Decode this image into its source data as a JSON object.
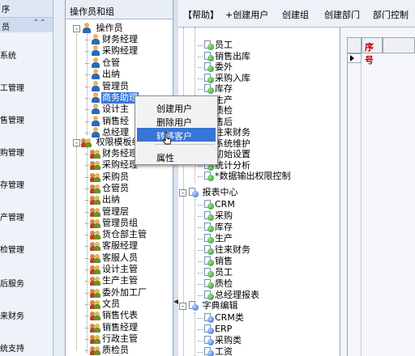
{
  "leftnav": {
    "header": "序",
    "top_item": "员",
    "items": [
      "系统",
      "工管理",
      "售管理",
      "购管理",
      "存管理",
      "产管理",
      "检管理",
      "后服务",
      "来财务",
      "统支持"
    ]
  },
  "tree": {
    "title": "操作员和组",
    "operators_root": "操作员",
    "operators": [
      "财务经理",
      "采购经理",
      "仓管",
      "出纳",
      "管理员",
      "商务助理",
      "设计主",
      "销售经",
      "总经理"
    ],
    "groups_root": "权限模板组",
    "groups": [
      "财务经理",
      "采购经理",
      "采购员",
      "仓管员",
      "出纳",
      "管理层",
      "管理员组",
      "货仓部主管",
      "客服经理",
      "客服人员",
      "设计主管",
      "生产主管",
      "委外加工厂",
      "文员",
      "销售代表",
      "销售经理",
      "行政主管",
      "质检员"
    ]
  },
  "context_menu": {
    "items": [
      "创建用户",
      "删除用户",
      "转移客户",
      "属性"
    ]
  },
  "toolbar": {
    "help": "【帮助】",
    "create_user": "+创建用户",
    "create_group": "创建组",
    "create_dept": "创建部门",
    "dept_control": "部门控制"
  },
  "rtree": {
    "group1_items": [
      "员工",
      "销售出库",
      "委外",
      "采购入库",
      "库存",
      "生产",
      "质检",
      "售后",
      "往来财务",
      "系统维护",
      "初始设置",
      "统计分析",
      "*数据输出权限控制"
    ],
    "report_center": "报表中心",
    "report_items": [
      "CRM",
      "采购",
      "库存",
      "生产",
      "往来财务",
      "销售",
      "员工",
      "质检",
      "总经理报表"
    ],
    "dict_editor": "字典编辑",
    "dict_items": [
      "CRM类",
      "ERP",
      "采购类",
      "工资"
    ]
  },
  "grid": {
    "col_seq": "序号"
  }
}
